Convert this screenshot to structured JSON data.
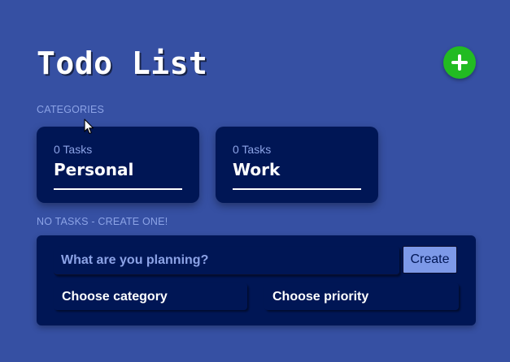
{
  "header": {
    "title": "Todo List",
    "add_button_icon": "plus-icon",
    "add_button_color": "#22bb22"
  },
  "categories_section": {
    "label": "CATEGORIES",
    "cards": [
      {
        "count_label": "0 Tasks",
        "name": "Personal"
      },
      {
        "count_label": "0 Tasks",
        "name": "Work"
      }
    ]
  },
  "tasks_section": {
    "label": "NO TASKS - CREATE ONE!"
  },
  "form": {
    "task_input_value": "",
    "task_input_placeholder": "What are you planning?",
    "create_button_label": "Create",
    "category_select_value": "Choose category",
    "priority_select_value": "Choose priority"
  },
  "colors": {
    "background": "#3650a3",
    "card_background": "#001655",
    "muted_text": "#8ca3e6",
    "create_button": "#7d99e8"
  }
}
